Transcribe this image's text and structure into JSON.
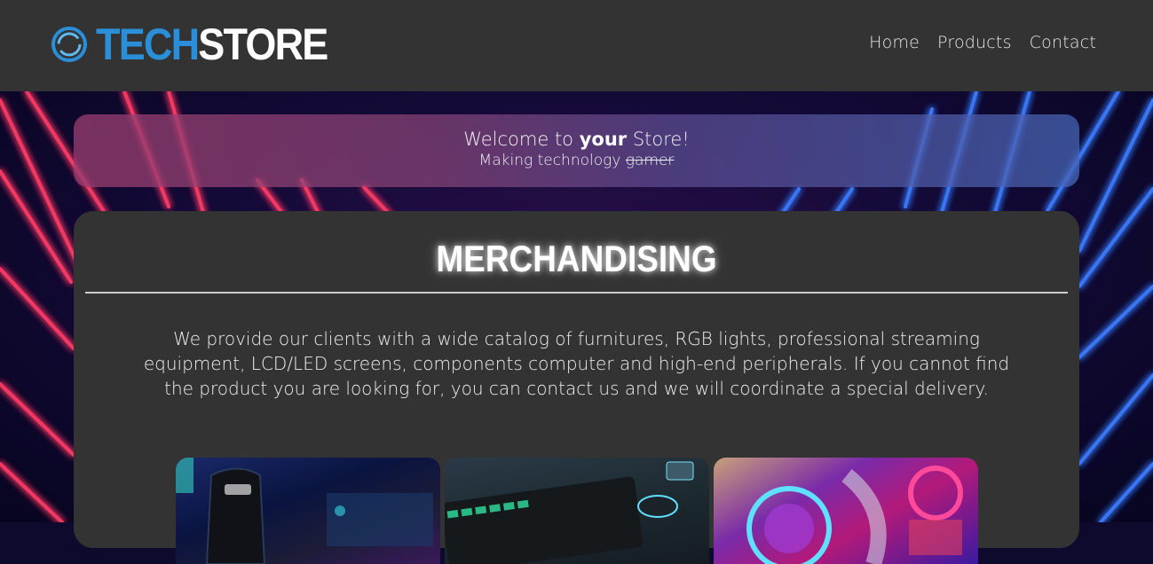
{
  "header": {
    "logo": {
      "part1": "TECH",
      "part2": "STORE",
      "icon": "ring-logo-icon"
    },
    "nav": [
      {
        "label": "Home"
      },
      {
        "label": "Products"
      },
      {
        "label": "Contact"
      }
    ]
  },
  "banner": {
    "welcome_before": "Welcome to ",
    "welcome_emph": "your",
    "welcome_after": " Store!",
    "tagline_before": "Making technology ",
    "tagline_struck": "gamer"
  },
  "main": {
    "title": "MERCHANDISING",
    "description": "We provide our clients with a wide catalog of furnitures, RGB lights, professional streaming equipment, LCD/LED screens, components computer and high-end peripherals. If you cannot find the product you are looking for, you can contact us and we will coordinate a special delivery."
  },
  "gallery": [
    {
      "subject": "gaming-chair-photo"
    },
    {
      "subject": "rgb-keyboard-photo"
    },
    {
      "subject": "rgb-lights-pc-photo"
    }
  ],
  "colors": {
    "header_bg": "#333333",
    "brand_blue": "#2a8fd8",
    "card_bg": "#333333",
    "neon_red": "#ff2a55",
    "neon_blue": "#2a6dff"
  }
}
